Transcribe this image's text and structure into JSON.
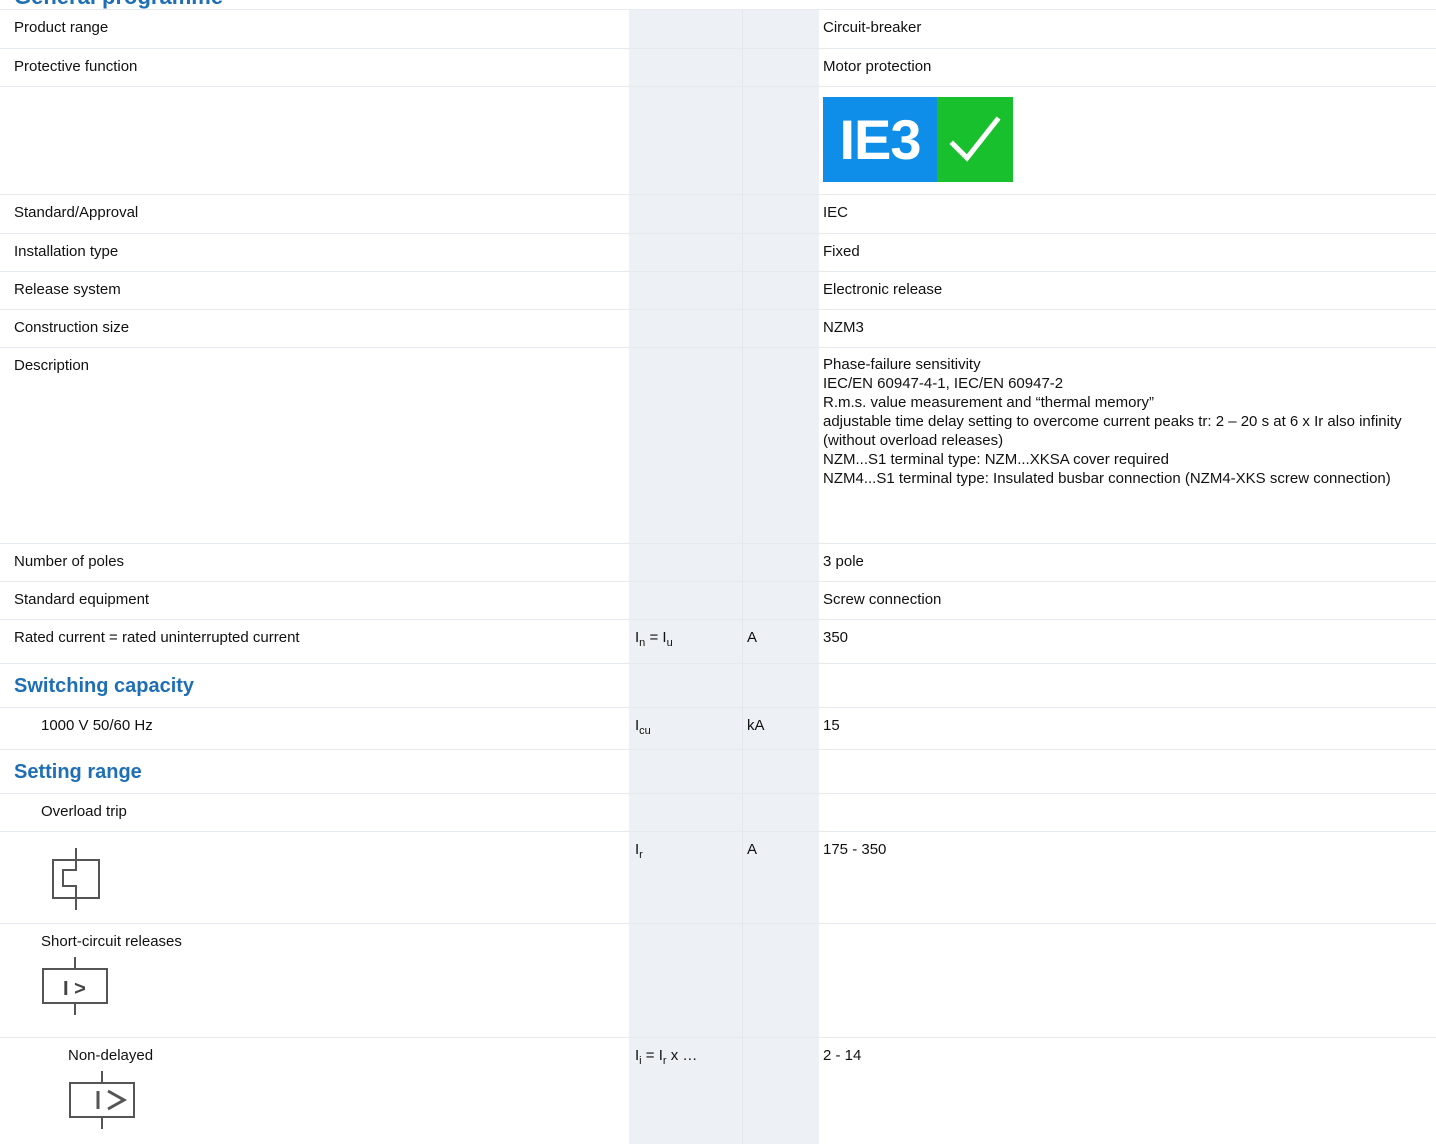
{
  "section_top_title": "General programme",
  "rows_general": [
    {
      "label": "Product range",
      "value": "Circuit-breaker"
    },
    {
      "label": "Protective function",
      "value": "Motor protection"
    }
  ],
  "logo": {
    "text": "IE3",
    "icon": "check-icon",
    "text_bg": "#0e8ee8",
    "check_bg": "#19c02e"
  },
  "rows_general2": [
    {
      "label": "Standard/Approval",
      "value": "IEC"
    },
    {
      "label": "Installation type",
      "value": "Fixed"
    },
    {
      "label": "Release system",
      "value": "Electronic release"
    },
    {
      "label": "Construction size",
      "value": "NZM3"
    }
  ],
  "description": {
    "label": "Description",
    "lines": [
      "Phase-failure sensitivity",
      "IEC/EN 60947-4-1, IEC/EN 60947-2",
      "R.m.s. value measurement and “thermal memory”",
      "adjustable time delay setting to overcome current peaks tr: 2 – 20 s at 6 x Ir also infinity (without overload releases)",
      "NZM...S1 terminal type: NZM...XKSA cover required",
      "NZM4...S1 terminal type: Insulated busbar connection (NZM4-XKS screw connection)"
    ]
  },
  "rows_general3": [
    {
      "label": "Number of poles",
      "value": "3 pole"
    },
    {
      "label": "Standard equipment",
      "value": "Screw connection"
    }
  ],
  "rated_current": {
    "label": "Rated current = rated uninterrupted current",
    "sym_a": "I",
    "sub_a": "n",
    "eq": " = ",
    "sym_b": "I",
    "sub_b": "u",
    "unit": "A",
    "value": "350"
  },
  "switching": {
    "title": "Switching capacity",
    "row": {
      "label": "1000 V 50/60 Hz",
      "sym": "I",
      "sub": "cu",
      "unit": "kA",
      "value": "15"
    }
  },
  "setting": {
    "title": "Setting range",
    "overload_label": "Overload trip",
    "overload": {
      "sym": "I",
      "sub": "r",
      "unit": "A",
      "value": "175 - 350",
      "icon": "overload-release-icon"
    },
    "short_circuit_label": "Short-circuit releases",
    "short_circuit_icon": "short-circuit-release-icon",
    "non_delayed": {
      "label": "Non-delayed",
      "sym_a": "I",
      "sub_a": "i",
      "eq": " = ",
      "sym_b": "I",
      "sub_b": "r",
      "suffix": " x …",
      "value": "2 - 14",
      "icon": "instantaneous-release-icon"
    }
  }
}
